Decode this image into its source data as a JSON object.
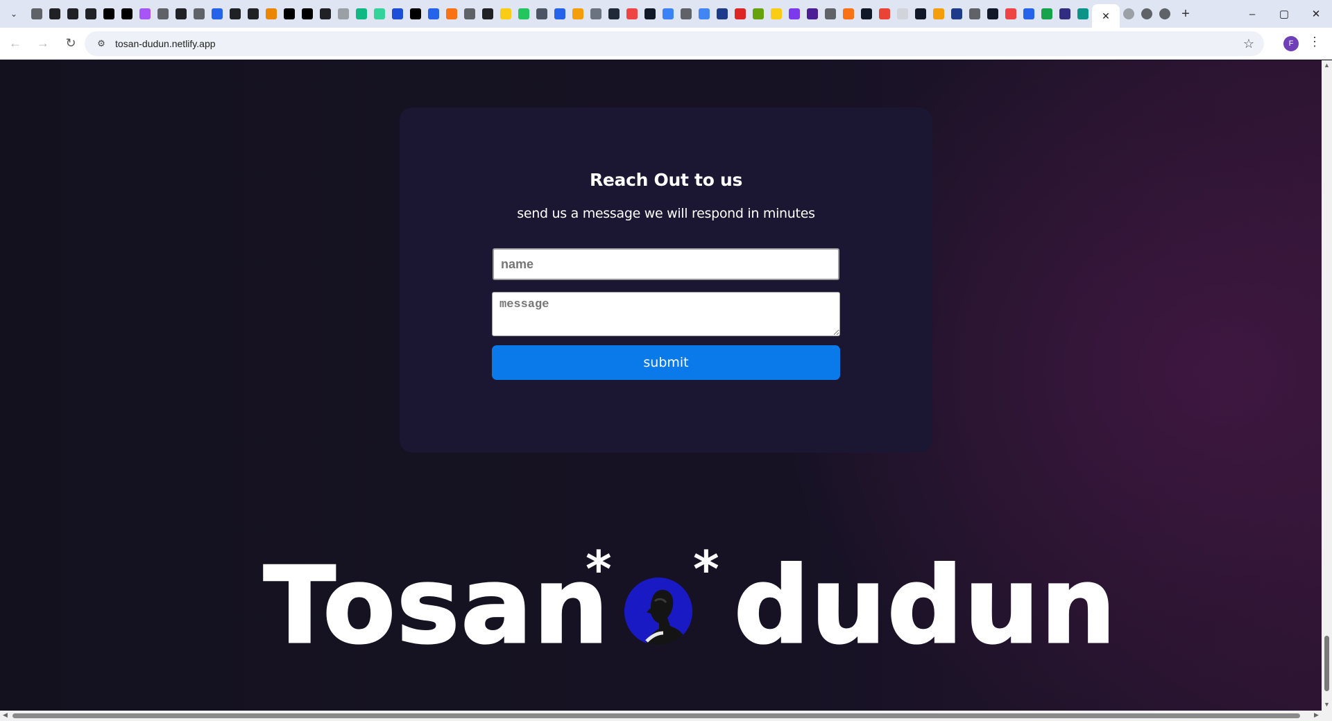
{
  "browser": {
    "url": "tosan-dudun.netlify.app",
    "profile_initial": "F",
    "tab_favicon_colors": [
      "#5f6368",
      "#202124",
      "#202124",
      "#202124",
      "#000000",
      "#000000",
      "#a855f7",
      "#5f6368",
      "#202124",
      "#5f6368",
      "#2563eb",
      "#202124",
      "#202124",
      "#ea8600",
      "#000000",
      "#000000",
      "#202124",
      "#9aa0a6",
      "#10b981",
      "#34d399",
      "#1d4ed8",
      "#000000",
      "#2563eb",
      "#f97316",
      "#5f6368",
      "#202124",
      "#facc15",
      "#22c55e",
      "#4b5563",
      "#2563eb",
      "#f59e0b",
      "#6b7280",
      "#1f2937",
      "#ef4444",
      "#111827",
      "#3b82f6",
      "#5f6368",
      "#4285f4",
      "#1e3a8a",
      "#dc2626",
      "#65a30d",
      "#facc15",
      "#7c3aed",
      "#4c1d95",
      "#5f6368",
      "#f97316",
      "#111827",
      "#ea4335",
      "#d1d5db",
      "#111827",
      "#f59e0b",
      "#1e3a8a",
      "#5f6368",
      "#111827",
      "#ef4444",
      "#2563eb",
      "#16a34a",
      "#312e81",
      "#0d9488"
    ],
    "window_controls": [
      "–",
      "▢",
      "✕"
    ]
  },
  "contact": {
    "title": "Reach Out to us",
    "subtitle": "send us a message we will respond in minutes",
    "name_placeholder": "name",
    "message_placeholder": "message",
    "submit_label": "submit"
  },
  "brand": {
    "left_text": "Tosan",
    "right_text": "dudun",
    "asterisk": "*"
  }
}
